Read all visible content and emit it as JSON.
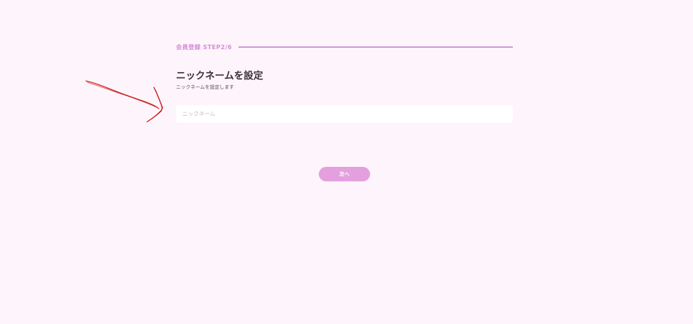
{
  "registration": {
    "step_label": "会員登録 STEP2/6",
    "title": "ニックネームを設定",
    "subtitle": "ニックネームを設定します"
  },
  "form": {
    "nickname_placeholder": "ニックネーム",
    "nickname_value": ""
  },
  "actions": {
    "next_label": "次へ"
  },
  "colors": {
    "background": "#fdf5fb",
    "accent": "#d58ed8",
    "progress_line": "#c79ad3",
    "button": "#e4a0de",
    "annotation": "#cc1f1f"
  }
}
